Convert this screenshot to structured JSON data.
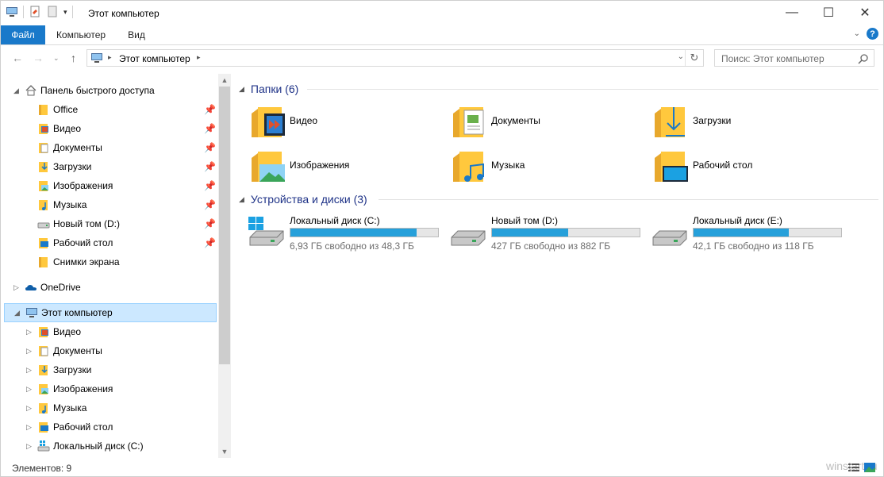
{
  "window": {
    "title": "Этот компьютер",
    "controls": {
      "minimize": "—",
      "maximize": "☐",
      "close": "✕"
    }
  },
  "ribbon": {
    "tabs": [
      "Файл",
      "Компьютер",
      "Вид"
    ],
    "help": "?"
  },
  "address": {
    "crumb": "Этот компьютер",
    "search_placeholder": "Поиск: Этот компьютер"
  },
  "nav": {
    "quick_access": "Панель быстрого доступа",
    "quick_items": [
      {
        "label": "Office",
        "icon": "folder-icon",
        "pinned": true
      },
      {
        "label": "Видео",
        "icon": "video-folder-icon",
        "pinned": true
      },
      {
        "label": "Документы",
        "icon": "documents-folder-icon",
        "pinned": true
      },
      {
        "label": "Загрузки",
        "icon": "downloads-folder-icon",
        "pinned": true
      },
      {
        "label": "Изображения",
        "icon": "pictures-folder-icon",
        "pinned": true
      },
      {
        "label": "Музыка",
        "icon": "music-folder-icon",
        "pinned": true
      },
      {
        "label": "Новый том (D:)",
        "icon": "drive-icon",
        "pinned": true
      },
      {
        "label": "Рабочий стол",
        "icon": "desktop-folder-icon",
        "pinned": true
      },
      {
        "label": "Снимки экрана",
        "icon": "folder-icon",
        "pinned": false
      }
    ],
    "onedrive": "OneDrive",
    "this_pc": "Этот компьютер",
    "pc_items": [
      {
        "label": "Видео",
        "icon": "video-folder-icon"
      },
      {
        "label": "Документы",
        "icon": "documents-folder-icon"
      },
      {
        "label": "Загрузки",
        "icon": "downloads-folder-icon"
      },
      {
        "label": "Изображения",
        "icon": "pictures-folder-icon"
      },
      {
        "label": "Музыка",
        "icon": "music-folder-icon"
      },
      {
        "label": "Рабочий стол",
        "icon": "desktop-folder-icon"
      },
      {
        "label": "Локальный диск (C:)",
        "icon": "system-drive-icon"
      }
    ]
  },
  "content": {
    "folders_header": "Папки (6)",
    "folders": [
      {
        "name": "Видео",
        "icon": "video-folder-icon"
      },
      {
        "name": "Документы",
        "icon": "documents-folder-icon"
      },
      {
        "name": "Загрузки",
        "icon": "downloads-folder-icon"
      },
      {
        "name": "Изображения",
        "icon": "pictures-folder-icon"
      },
      {
        "name": "Музыка",
        "icon": "music-folder-icon"
      },
      {
        "name": "Рабочий стол",
        "icon": "desktop-folder-icon"
      }
    ],
    "drives_header": "Устройства и диски (3)",
    "drives": [
      {
        "name": "Локальный диск (C:)",
        "free": "6,93 ГБ свободно из 48,3 ГБ",
        "used_fraction": 0.857,
        "system": true
      },
      {
        "name": "Новый том (D:)",
        "free": "427 ГБ свободно из 882 ГБ",
        "used_fraction": 0.516,
        "system": false
      },
      {
        "name": "Локальный диск (E:)",
        "free": "42,1 ГБ свободно из 118 ГБ",
        "used_fraction": 0.643,
        "system": false
      }
    ]
  },
  "status": {
    "count": "Элементов: 9",
    "watermark": "winstart.ru"
  },
  "colors": {
    "accent": "#1979ca",
    "folder": "#ffc83d",
    "bar_fill": "#26a0da",
    "selection": "#cce8ff"
  }
}
